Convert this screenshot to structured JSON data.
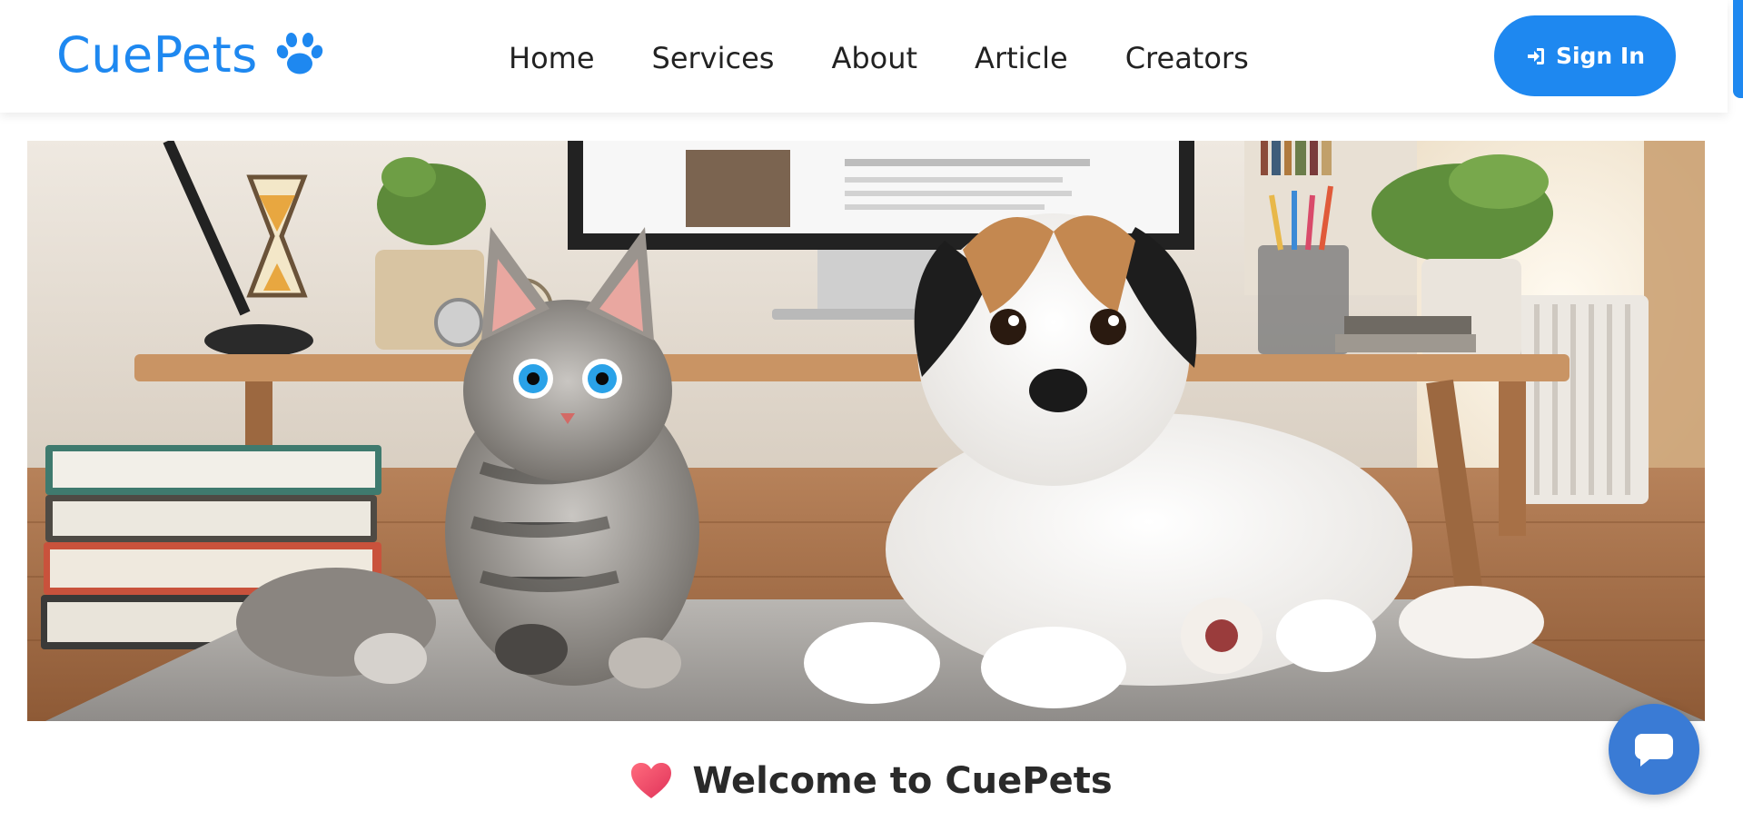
{
  "brand": {
    "name": "CuePets",
    "icon": "paw-icon",
    "color": "#1e88f0"
  },
  "nav": {
    "links": [
      {
        "label": "Home"
      },
      {
        "label": "Services"
      },
      {
        "label": "About"
      },
      {
        "label": "Article"
      },
      {
        "label": "Creators"
      }
    ],
    "signin": {
      "label": "Sign In",
      "icon": "sign-in-icon"
    }
  },
  "hero": {
    "image": "hero-image",
    "subjects": [
      "kitten",
      "puppy"
    ]
  },
  "welcome": {
    "icon": "heart-icon",
    "title": "Welcome to CuePets"
  },
  "chat": {
    "icon": "chat-bubble-icon"
  },
  "colors": {
    "accent": "#1e88f0",
    "chat": "#3a7bd5",
    "heart": "#f0466a",
    "text": "#222222"
  }
}
